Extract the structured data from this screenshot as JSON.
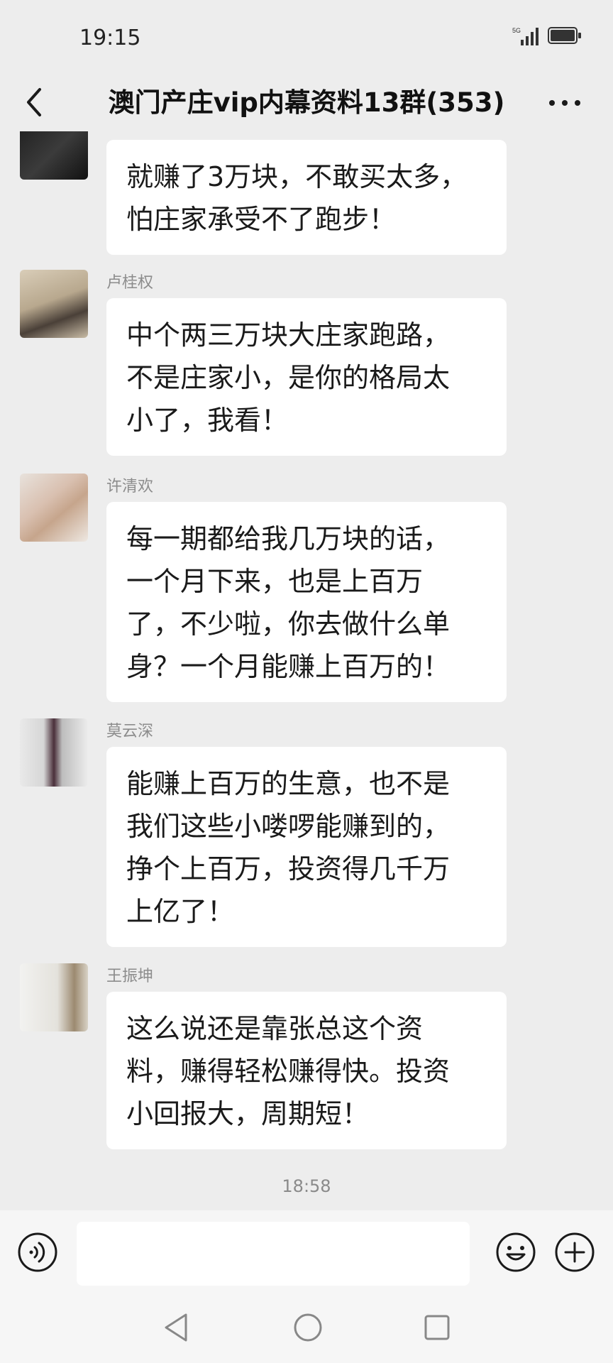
{
  "status": {
    "time": "19:15",
    "network": "5G"
  },
  "header": {
    "title": "澳门产庄vip内幕资料13群(353)"
  },
  "messages": [
    {
      "sender": "",
      "text": "就赚了3万块，不敢买太多，\n怕庄家承受不了跑步！"
    },
    {
      "sender": "卢桂权",
      "text": "中个两三万块大庄家跑路，\n不是庄家小，是你的格局太\n小了，我看！"
    },
    {
      "sender": "许清欢",
      "text": "每一期都给我几万块的话，\n一个月下来，也是上百万\n了，不少啦，你去做什么单\n身？一个月能赚上百万的！"
    },
    {
      "sender": "莫云深",
      "text": "能赚上百万的生意，也不是\n我们这些小喽啰能赚到的，\n挣个上百万，投资得几千万\n上亿了！"
    },
    {
      "sender": "王振坤",
      "text": "这么说还是靠张总这个资\n料，赚得轻松赚得快。投资\n小回报大，周期短！"
    }
  ],
  "timestamp": "18:58",
  "input": {
    "value": ""
  },
  "icons": {
    "back": "chevron-left-icon",
    "more": "more-dots-icon",
    "voice": "voice-icon",
    "emoji": "emoji-icon",
    "plus": "plus-icon"
  }
}
